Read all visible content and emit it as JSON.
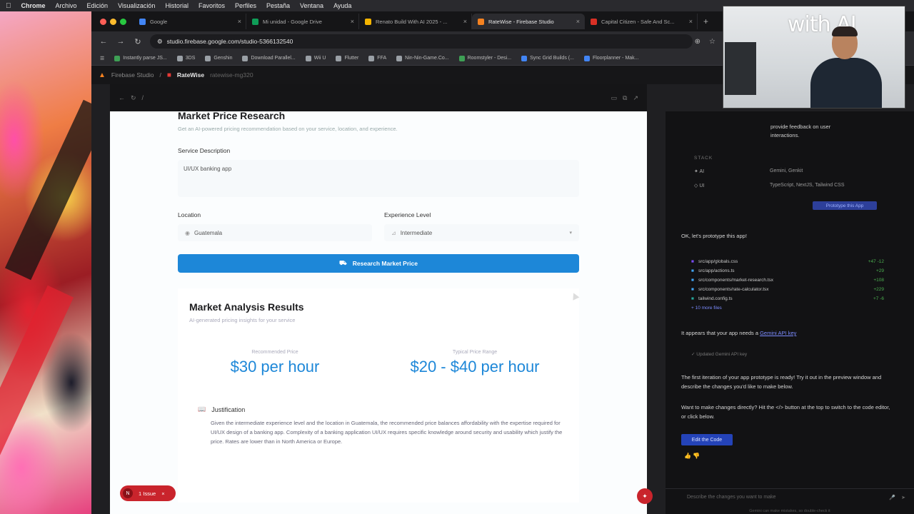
{
  "menubar": {
    "app": "Chrome",
    "items": [
      "Archivo",
      "Edición",
      "Visualización",
      "Historial",
      "Favoritos",
      "Perfiles",
      "Pestaña",
      "Ventana",
      "Ayuda"
    ]
  },
  "tabs": [
    {
      "label": "Google",
      "color": "#4285f4"
    },
    {
      "label": "Mi unidad - Google Drive",
      "color": "#0f9d58"
    },
    {
      "label": "Renato Build With AI 2025 - ...",
      "color": "#f4b400"
    },
    {
      "label": "RateWise - Firebase Studio",
      "color": "#f58220"
    },
    {
      "label": "Capital Citizen - Safe And Sc...",
      "color": "#d93025"
    }
  ],
  "address": {
    "url": "studio.firebase.google.com/studio-5366132540"
  },
  "bookmarks": [
    {
      "label": "Instantly parse JS...",
      "color": "#3ea055"
    },
    {
      "label": "3DS",
      "color": "#9aa0a6"
    },
    {
      "label": "Genshin",
      "color": "#9aa0a6"
    },
    {
      "label": "Download Parallel...",
      "color": "#9aa0a6"
    },
    {
      "label": "Wii U",
      "color": "#9aa0a6"
    },
    {
      "label": "Flutter",
      "color": "#9aa0a6"
    },
    {
      "label": "FFA",
      "color": "#9aa0a6"
    },
    {
      "label": "Nin-Nin-Game.Co...",
      "color": "#9aa0a6"
    },
    {
      "label": "Roomstyler - Desi...",
      "color": "#3ea055"
    },
    {
      "label": "Sync Grid Builds (...",
      "color": "#4285f4"
    },
    {
      "label": "Floorplanner - Mak...",
      "color": "#4285f4"
    }
  ],
  "studio": {
    "brand": "Firebase Studio",
    "project": "RateWise",
    "workspace": "ratewise-mg320"
  },
  "preview": {
    "title": "Market Price Research",
    "subtitle": "Get an AI-powered pricing recommendation based on your service, location, and experience.",
    "service_label": "Service Description",
    "service_value": "UI/UX banking app",
    "location_label": "Location",
    "location_value": "Guatemala",
    "experience_label": "Experience Level",
    "experience_value": "Intermediate",
    "button": "Research Market Price",
    "results": {
      "title": "Market Analysis Results",
      "subtitle": "AI-generated pricing insights for your service",
      "recommended_label": "Recommended Price",
      "recommended_value": "$30 per hour",
      "range_label": "Typical Price Range",
      "range_value": "$20 - $40 per hour",
      "justification_title": "Justification",
      "justification_text": "Given the intermediate experience level and the location in Guatemala, the recommended price balances affordability with the expertise required for UI/UX design of a banking app. Complexity of a banking application UI/UX requires specific knowledge around security and usability which justify the price. Rates are lower than in North America or Europe."
    },
    "issue_badge": "1 Issue",
    "issue_initial": "N"
  },
  "chat": {
    "feedback": "provide feedback on user interactions.",
    "stack_label": "STACK",
    "stack": [
      {
        "key": "AI",
        "value": "Gemini, Genkit"
      },
      {
        "key": "UI",
        "value": "TypeScript, NextJS, Tailwind CSS"
      }
    ],
    "prototype_button": "Prototype this App",
    "msg1": "OK, let's prototype this app!",
    "files": [
      {
        "name": "src/app/globals.css",
        "diff": "+47 -12"
      },
      {
        "name": "src/app/actions.ts",
        "diff": "+29"
      },
      {
        "name": "src/components/market-research.tsx",
        "diff": "+108"
      },
      {
        "name": "src/components/rate-calculator.tsx",
        "diff": "+229"
      },
      {
        "name": "tailwind.config.ts",
        "diff": "+7 -6"
      },
      {
        "name": "+ 10 more files",
        "diff": ""
      }
    ],
    "api_msg_prefix": "It appears that your app needs a",
    "api_link": "Gemini API key",
    "api_status": "Updated Gemini API key",
    "msg2": "The first iteration of your app prototype is ready! Try it out in the preview window and describe the changes you'd like to make below.",
    "msg3": "Want to make changes directly? Hit the </> button at the top to switch to the code editor, or click below.",
    "edit_button": "Edit the Code",
    "composer_placeholder": "Describe the changes you want to make",
    "composer_hint": "Gemini can make mistakes, so double-check it"
  },
  "webcam": {
    "brand": "with AI"
  }
}
